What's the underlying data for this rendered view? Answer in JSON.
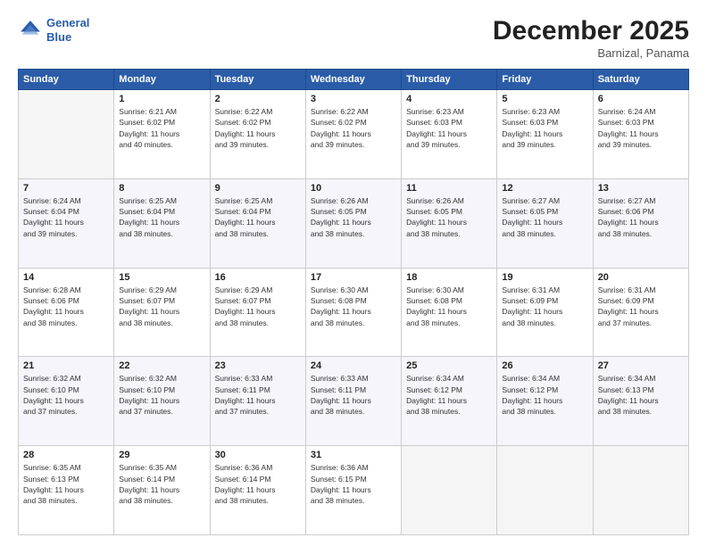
{
  "header": {
    "logo_line1": "General",
    "logo_line2": "Blue",
    "month": "December 2025",
    "location": "Barnizal, Panama"
  },
  "weekdays": [
    "Sunday",
    "Monday",
    "Tuesday",
    "Wednesday",
    "Thursday",
    "Friday",
    "Saturday"
  ],
  "weeks": [
    [
      {
        "date": "",
        "info": ""
      },
      {
        "date": "1",
        "info": "Sunrise: 6:21 AM\nSunset: 6:02 PM\nDaylight: 11 hours\nand 40 minutes."
      },
      {
        "date": "2",
        "info": "Sunrise: 6:22 AM\nSunset: 6:02 PM\nDaylight: 11 hours\nand 39 minutes."
      },
      {
        "date": "3",
        "info": "Sunrise: 6:22 AM\nSunset: 6:02 PM\nDaylight: 11 hours\nand 39 minutes."
      },
      {
        "date": "4",
        "info": "Sunrise: 6:23 AM\nSunset: 6:03 PM\nDaylight: 11 hours\nand 39 minutes."
      },
      {
        "date": "5",
        "info": "Sunrise: 6:23 AM\nSunset: 6:03 PM\nDaylight: 11 hours\nand 39 minutes."
      },
      {
        "date": "6",
        "info": "Sunrise: 6:24 AM\nSunset: 6:03 PM\nDaylight: 11 hours\nand 39 minutes."
      }
    ],
    [
      {
        "date": "7",
        "info": "Sunrise: 6:24 AM\nSunset: 6:04 PM\nDaylight: 11 hours\nand 39 minutes."
      },
      {
        "date": "8",
        "info": "Sunrise: 6:25 AM\nSunset: 6:04 PM\nDaylight: 11 hours\nand 38 minutes."
      },
      {
        "date": "9",
        "info": "Sunrise: 6:25 AM\nSunset: 6:04 PM\nDaylight: 11 hours\nand 38 minutes."
      },
      {
        "date": "10",
        "info": "Sunrise: 6:26 AM\nSunset: 6:05 PM\nDaylight: 11 hours\nand 38 minutes."
      },
      {
        "date": "11",
        "info": "Sunrise: 6:26 AM\nSunset: 6:05 PM\nDaylight: 11 hours\nand 38 minutes."
      },
      {
        "date": "12",
        "info": "Sunrise: 6:27 AM\nSunset: 6:05 PM\nDaylight: 11 hours\nand 38 minutes."
      },
      {
        "date": "13",
        "info": "Sunrise: 6:27 AM\nSunset: 6:06 PM\nDaylight: 11 hours\nand 38 minutes."
      }
    ],
    [
      {
        "date": "14",
        "info": "Sunrise: 6:28 AM\nSunset: 6:06 PM\nDaylight: 11 hours\nand 38 minutes."
      },
      {
        "date": "15",
        "info": "Sunrise: 6:29 AM\nSunset: 6:07 PM\nDaylight: 11 hours\nand 38 minutes."
      },
      {
        "date": "16",
        "info": "Sunrise: 6:29 AM\nSunset: 6:07 PM\nDaylight: 11 hours\nand 38 minutes."
      },
      {
        "date": "17",
        "info": "Sunrise: 6:30 AM\nSunset: 6:08 PM\nDaylight: 11 hours\nand 38 minutes."
      },
      {
        "date": "18",
        "info": "Sunrise: 6:30 AM\nSunset: 6:08 PM\nDaylight: 11 hours\nand 38 minutes."
      },
      {
        "date": "19",
        "info": "Sunrise: 6:31 AM\nSunset: 6:09 PM\nDaylight: 11 hours\nand 38 minutes."
      },
      {
        "date": "20",
        "info": "Sunrise: 6:31 AM\nSunset: 6:09 PM\nDaylight: 11 hours\nand 37 minutes."
      }
    ],
    [
      {
        "date": "21",
        "info": "Sunrise: 6:32 AM\nSunset: 6:10 PM\nDaylight: 11 hours\nand 37 minutes."
      },
      {
        "date": "22",
        "info": "Sunrise: 6:32 AM\nSunset: 6:10 PM\nDaylight: 11 hours\nand 37 minutes."
      },
      {
        "date": "23",
        "info": "Sunrise: 6:33 AM\nSunset: 6:11 PM\nDaylight: 11 hours\nand 37 minutes."
      },
      {
        "date": "24",
        "info": "Sunrise: 6:33 AM\nSunset: 6:11 PM\nDaylight: 11 hours\nand 38 minutes."
      },
      {
        "date": "25",
        "info": "Sunrise: 6:34 AM\nSunset: 6:12 PM\nDaylight: 11 hours\nand 38 minutes."
      },
      {
        "date": "26",
        "info": "Sunrise: 6:34 AM\nSunset: 6:12 PM\nDaylight: 11 hours\nand 38 minutes."
      },
      {
        "date": "27",
        "info": "Sunrise: 6:34 AM\nSunset: 6:13 PM\nDaylight: 11 hours\nand 38 minutes."
      }
    ],
    [
      {
        "date": "28",
        "info": "Sunrise: 6:35 AM\nSunset: 6:13 PM\nDaylight: 11 hours\nand 38 minutes."
      },
      {
        "date": "29",
        "info": "Sunrise: 6:35 AM\nSunset: 6:14 PM\nDaylight: 11 hours\nand 38 minutes."
      },
      {
        "date": "30",
        "info": "Sunrise: 6:36 AM\nSunset: 6:14 PM\nDaylight: 11 hours\nand 38 minutes."
      },
      {
        "date": "31",
        "info": "Sunrise: 6:36 AM\nSunset: 6:15 PM\nDaylight: 11 hours\nand 38 minutes."
      },
      {
        "date": "",
        "info": ""
      },
      {
        "date": "",
        "info": ""
      },
      {
        "date": "",
        "info": ""
      }
    ]
  ]
}
